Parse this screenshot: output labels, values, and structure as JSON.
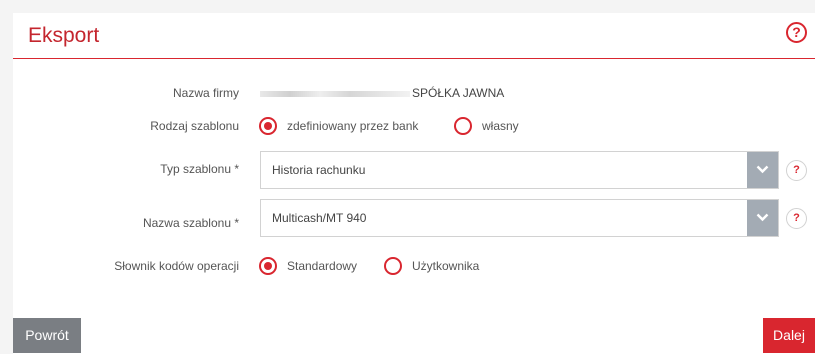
{
  "header": {
    "title": "Eksport",
    "help_icon": "question-circle-icon"
  },
  "form": {
    "company": {
      "label": "Nazwa firmy",
      "value": "SPÓŁKA JAWNA"
    },
    "template_kind": {
      "label": "Rodzaj szablonu",
      "options": [
        {
          "label": "zdefiniowany przez bank",
          "checked": true
        },
        {
          "label": "własny",
          "checked": false
        }
      ]
    },
    "template_type": {
      "label": "Typ szablonu *",
      "value": "Historia rachunku"
    },
    "template_name": {
      "label": "Nazwa szablonu *",
      "value": "Multicash/MT 940"
    },
    "dictionary": {
      "label": "Słownik kodów operacji",
      "options": [
        {
          "label": "Standardowy",
          "checked": true
        },
        {
          "label": "Użytkownika",
          "checked": false
        }
      ]
    }
  },
  "buttons": {
    "back": "Powrót",
    "next": "Dalej"
  },
  "help_glyph": "?",
  "colors": {
    "accent": "#d9262f",
    "back_button": "#7a7e83",
    "select_arrow": "#a3abb4"
  }
}
